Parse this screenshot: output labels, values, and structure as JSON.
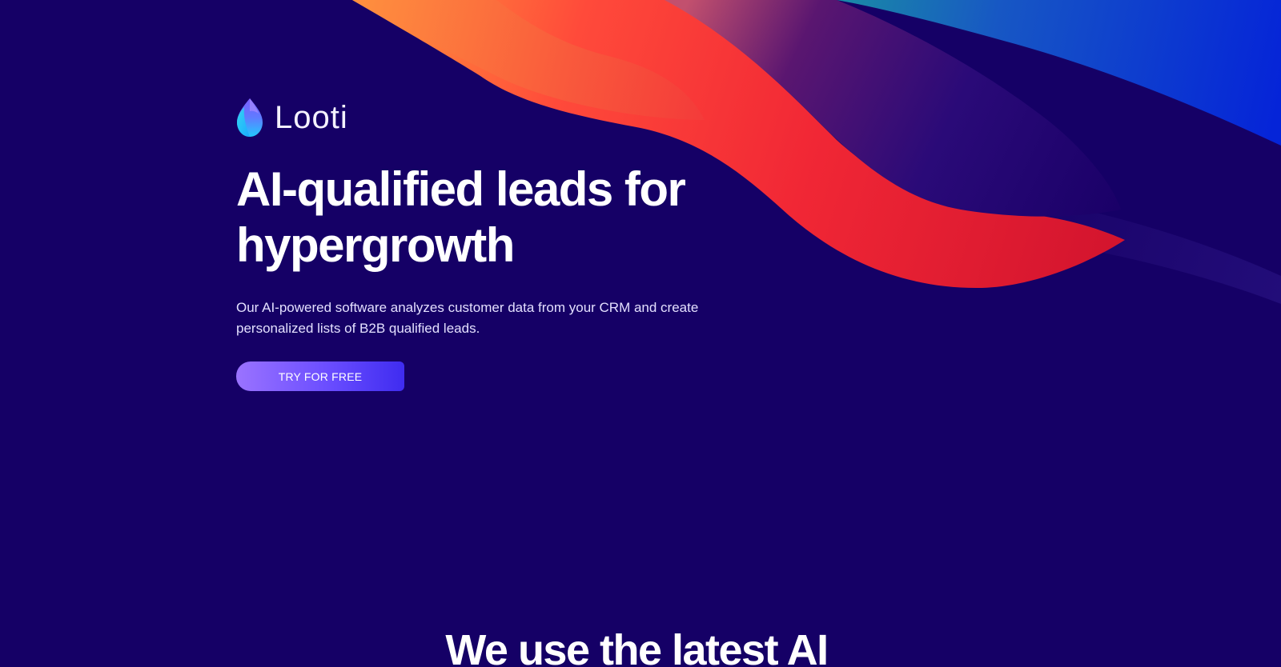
{
  "colors": {
    "background": "#150066",
    "cta_gradient_start": "#9a73ff",
    "cta_gradient_end": "#3f2cf0",
    "ribbon_orange": "#ff8a3c",
    "ribbon_red": "#f0253a",
    "ribbon_blue": "#0a2fd6"
  },
  "brand": {
    "name": "Looti",
    "logo_icon": "droplet-logo-icon"
  },
  "hero": {
    "title_line1": "AI-qualified leads for",
    "title_line2": "hypergrowth",
    "description": "Our AI-powered software analyzes customer data from your CRM  and create personalized lists of B2B qualified leads.",
    "cta_label": "TRY FOR FREE"
  },
  "next_section": {
    "heading": "We use the latest AI"
  }
}
